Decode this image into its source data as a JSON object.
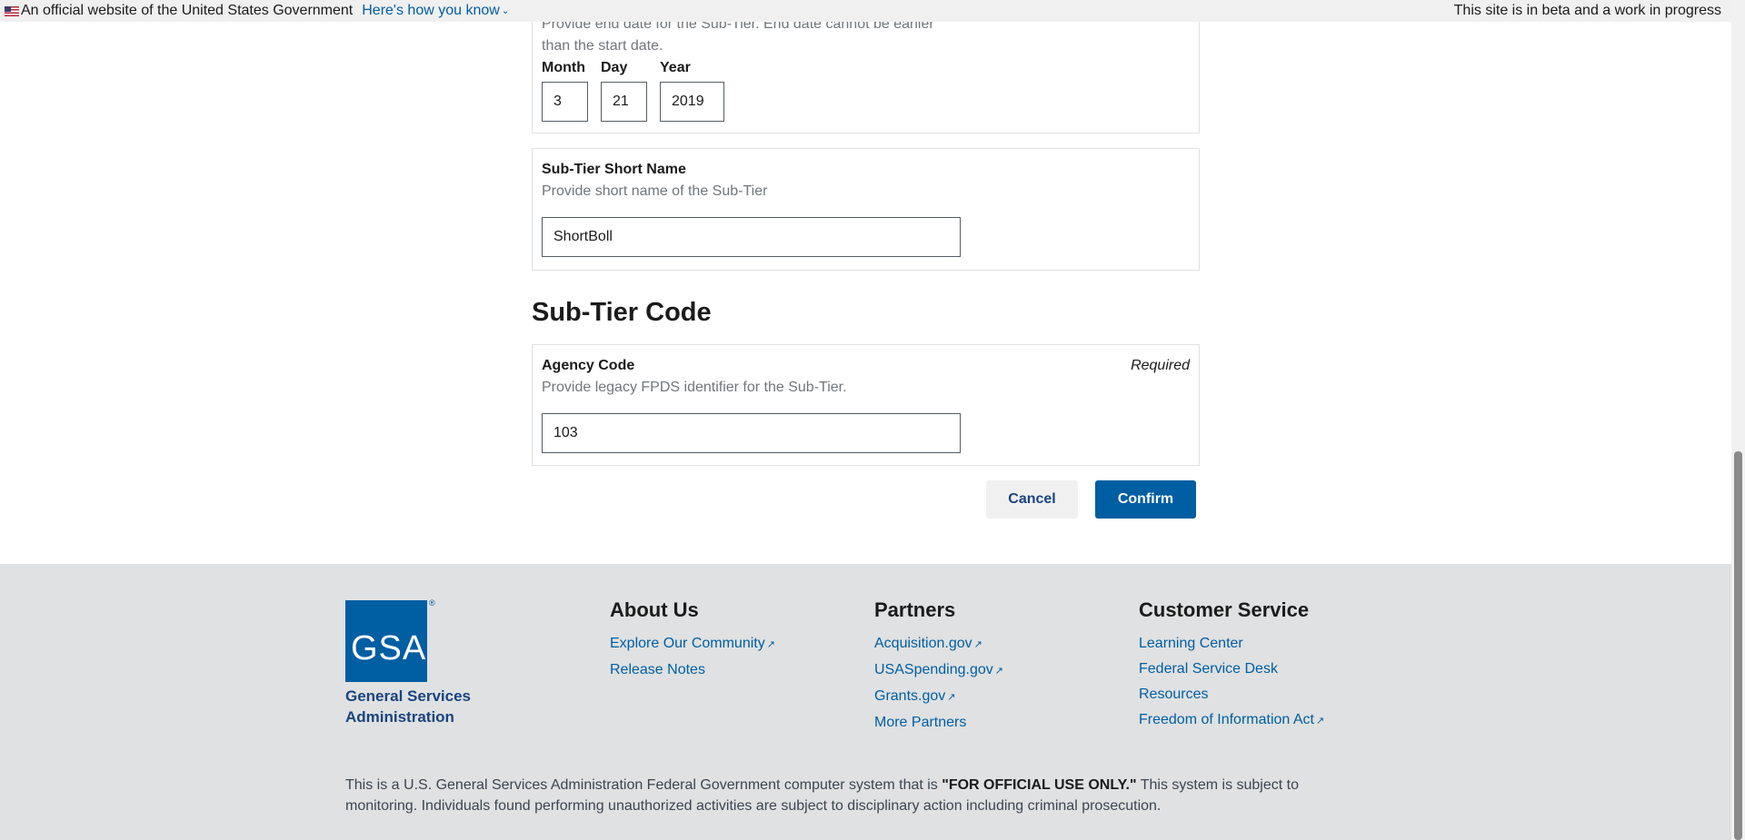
{
  "banner": {
    "official_text": "An official website of the United States Government",
    "how_link": "Here's how you know",
    "beta_text": "This site is in beta and a work in progress"
  },
  "end_date": {
    "help": "Provide end date for the Sub-Tier. End date cannot be earlier than the start date.",
    "month_label": "Month",
    "day_label": "Day",
    "year_label": "Year",
    "month_value": "3",
    "day_value": "21",
    "year_value": "2019"
  },
  "short_name": {
    "label": "Sub-Tier Short Name",
    "help": "Provide short name of the Sub-Tier",
    "value": "ShortBoll"
  },
  "code_section": {
    "heading": "Sub-Tier Code",
    "label": "Agency Code",
    "required": "Required",
    "help": "Provide legacy FPDS identifier for the Sub-Tier.",
    "value": "103"
  },
  "actions": {
    "cancel": "Cancel",
    "confirm": "Confirm"
  },
  "footer": {
    "logo_text": "GSA",
    "org_name": "General Services Administration",
    "about": {
      "heading": "About Us",
      "links": [
        "Explore Our Community",
        "Release Notes"
      ]
    },
    "partners": {
      "heading": "Partners",
      "links": [
        "Acquisition.gov",
        "USASpending.gov",
        "Grants.gov",
        "More Partners"
      ]
    },
    "customer": {
      "heading": "Customer Service",
      "links": [
        "Learning Center",
        "Federal Service Desk",
        "Resources",
        "Freedom of Information Act"
      ]
    },
    "disclaimer_pre": "This is a U.S. General Services Administration Federal Government computer system that is ",
    "disclaimer_bold": "\"FOR OFFICIAL USE ONLY.\"",
    "disclaimer_post": " This system is subject to monitoring. Individuals found performing unauthorized activities are subject to disciplinary action including criminal prosecution."
  },
  "colors": {
    "primary": "#005ea2",
    "footer_bg": "#dfe1e2",
    "banner_bg": "#f0f0f0"
  }
}
